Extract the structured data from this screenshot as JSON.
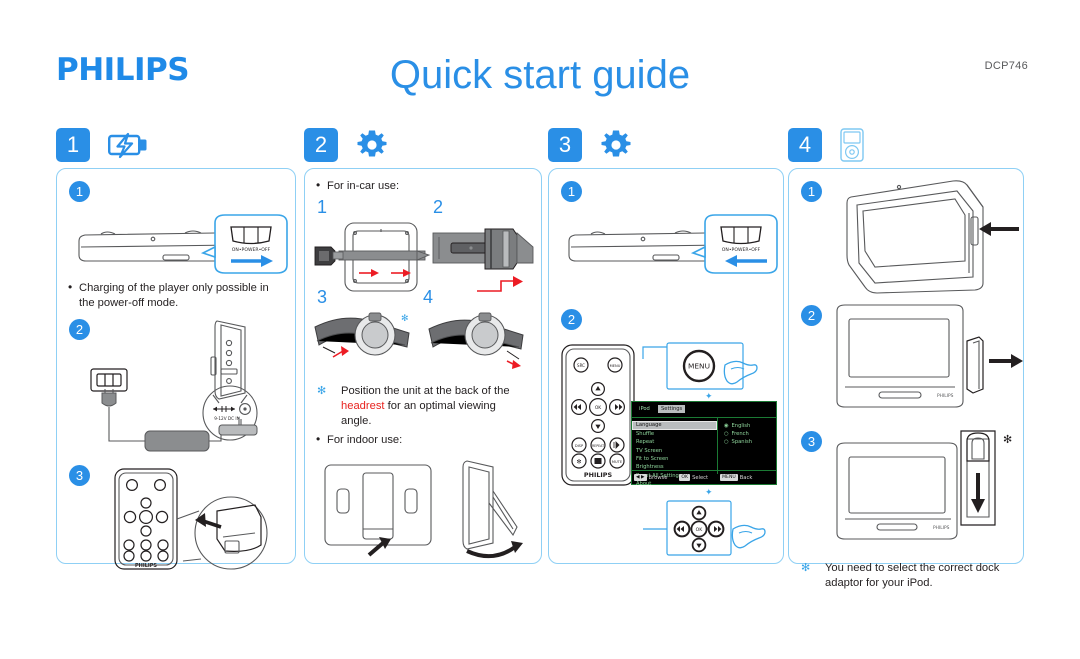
{
  "header": {
    "brand": "PHILIPS",
    "title": "Quick start guide",
    "model": "DCP746"
  },
  "panels": [
    {
      "number": "1",
      "icon": "battery-charging-icon",
      "substeps": [
        "1",
        "2",
        "3"
      ],
      "switch_label": "ON•POWER•OFF",
      "dc_label": "9-12V DC IN",
      "remote_brand": "PHILIPS",
      "texts": [
        "Charging of the player only possible in the power-off mode."
      ]
    },
    {
      "number": "2",
      "icon": "gear-icon",
      "intro": "For in-car use:",
      "substeps": [
        "1",
        "2",
        "3",
        "4"
      ],
      "note_prefix": "Position the unit at the back of the ",
      "note_highlight": "headrest",
      "note_suffix": " for an optimal viewing angle.",
      "indoor": "For indoor use:"
    },
    {
      "number": "3",
      "icon": "gear-icon",
      "substeps": [
        "1",
        "2"
      ],
      "switch_label": "ON•POWER•OFF",
      "menu_button": "MENU",
      "remote": {
        "brand": "PHILIPS",
        "buttons": [
          "SRC",
          "MENU",
          "OK",
          "DISP",
          "REPEAT",
          "MUTE"
        ]
      },
      "osd": {
        "tabs": [
          "iPod",
          "Settings"
        ],
        "selected_tab": "Settings",
        "items": [
          "Language",
          "Shuffle",
          "Repeat",
          "TV Screen",
          "Fit to Screen",
          "Brightness",
          "Reset All Settings",
          "About"
        ],
        "selected_item": "Language",
        "options": [
          "English",
          "French",
          "Spanish"
        ],
        "selected_option": "English",
        "bar": [
          {
            "key": "◀ ▶",
            "label": "Browse"
          },
          {
            "key": "OK",
            "label": "Select"
          },
          {
            "key": "MENU",
            "label": "Back"
          }
        ]
      }
    },
    {
      "number": "4",
      "icon": "ipod-icon",
      "substeps": [
        "1",
        "2",
        "3"
      ],
      "device_brand": "PHILIPS",
      "note": "You need to select the correct dock adaptor for your iPod."
    }
  ],
  "colors": {
    "brand_blue": "#2a8fe6",
    "panel_border": "#8fd0f5",
    "accent_red": "#ec1c24",
    "osd_green": "#8fd69c",
    "line_gray": "#58595b"
  }
}
